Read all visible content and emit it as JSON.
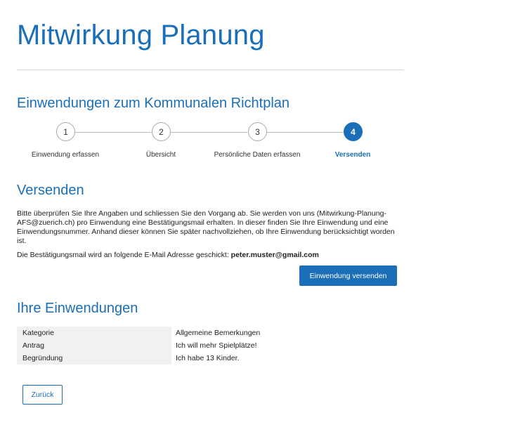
{
  "page_title": "Mitwirkung Planung",
  "section_heading": "Einwendungen zum Kommunalen Richtplan",
  "steps": [
    {
      "number": "1",
      "label": "Einwendung erfassen",
      "active": false
    },
    {
      "number": "2",
      "label": "Übersicht",
      "active": false
    },
    {
      "number": "3",
      "label": "Persönliche Daten erfassen",
      "active": false
    },
    {
      "number": "4",
      "label": "Versenden",
      "active": true
    }
  ],
  "send_section": {
    "heading": "Versenden",
    "paragraph": "Bitte überprüfen Sie Ihre Angaben und schliessen Sie den Vorgang ab. Sie werden von uns (Mitwirkung-Planung-AFS@zuerich.ch) pro Einwendung eine Bestätigungsmail erhalten. In dieser finden Sie Ihre Einwendung und eine Einwendungsnummer. Anhand dieser können Sie später nachvollziehen, ob Ihre Einwendung berücksichtigt worden ist.",
    "email_text": "Die Bestätigungsmail wird an folgende E-Mail Adresse geschickt:",
    "email_address": "peter.muster@gmail.com",
    "submit_label": "Einwendung versenden"
  },
  "objections": {
    "heading": "Ihre Einwendungen",
    "rows": [
      {
        "key": "Kategorie",
        "value": "Allgemeine Bemerkungen"
      },
      {
        "key": "Antrag",
        "value": "Ich will mehr Spielplätze!"
      },
      {
        "key": "Begründung",
        "value": "Ich habe 13 Kinder."
      }
    ]
  },
  "back_label": "Zurück",
  "colors": {
    "accent": "#1a6fb8",
    "table_key_bg": "#f1f1f1"
  }
}
